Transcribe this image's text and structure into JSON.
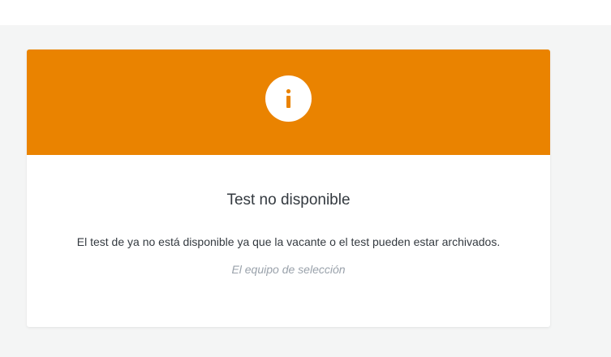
{
  "colors": {
    "header_accent": "#ea8300",
    "page_background": "#f4f5f5",
    "card_background": "#ffffff",
    "title_text": "#343a40",
    "signature_text": "#9aa2ab"
  },
  "icon": "info-icon",
  "card": {
    "title": "Test no disponible",
    "message": "El test de ya no está disponible ya que la vacante o el test pueden estar archivados.",
    "signature": "El equipo de selección"
  }
}
